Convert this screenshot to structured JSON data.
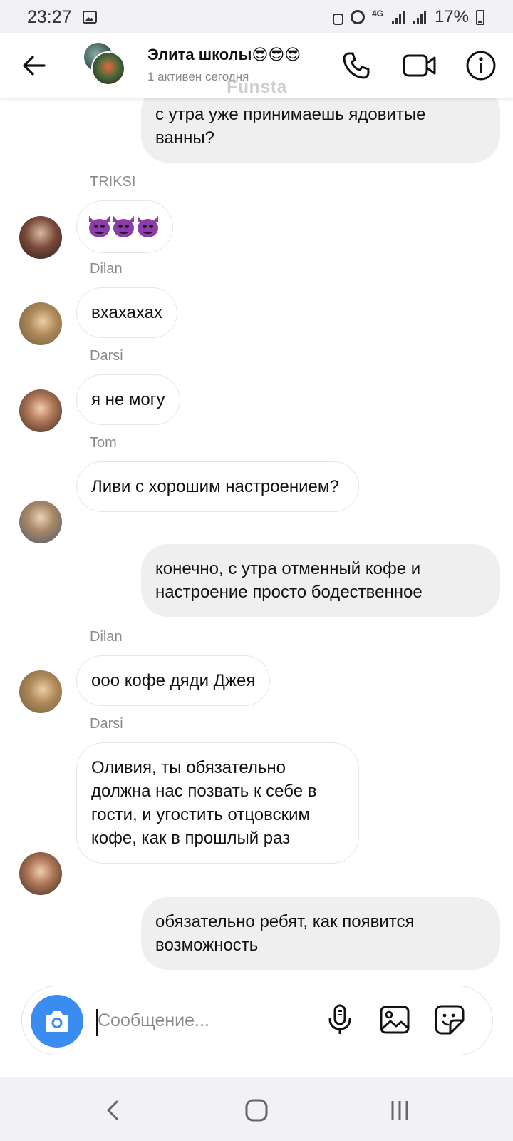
{
  "status": {
    "time": "23:27",
    "network": "4G",
    "battery": "17%"
  },
  "header": {
    "title": "Элита школы😎😎😎",
    "subtitle": "1 активен сегодня",
    "watermark": "Funsta"
  },
  "messages": [
    {
      "direction": "out",
      "text": "с утра уже принимаешь ядовитые ванны?"
    },
    {
      "direction": "in",
      "sender": "TRIKSI",
      "emoji": [
        "devil",
        "devil",
        "devil"
      ]
    },
    {
      "direction": "in",
      "sender": "Dilan",
      "text": "вхахахах"
    },
    {
      "direction": "in",
      "sender": "Darsi",
      "text": "я не могу"
    },
    {
      "direction": "in",
      "sender": "Tom",
      "text": "Ливи с хорошим настроением?"
    },
    {
      "direction": "out",
      "text": "конечно, с утра отменный кофе и настроение просто бодественное"
    },
    {
      "direction": "in",
      "sender": "Dilan",
      "text": "ооо кофе дяди Джея"
    },
    {
      "direction": "in",
      "sender": "Darsi",
      "text": "Оливия, ты обязательно должна нас позвать к себе в гости, и угостить отцовским кофе, как в прошлый раз"
    },
    {
      "direction": "out",
      "text": "обязательно ребят, как появится возможность"
    }
  ],
  "composer": {
    "placeholder": "Сообщение..."
  },
  "icons": {
    "header": [
      "back-arrow-icon",
      "phone-icon",
      "video-call-icon",
      "info-icon"
    ],
    "composer": [
      "camera-icon",
      "microphone-icon",
      "gallery-icon",
      "sticker-icon"
    ],
    "nav": [
      "nav-back-icon",
      "nav-home-icon",
      "nav-recents-icon"
    ]
  },
  "colors": {
    "accent": "#3b8cf0",
    "outgoing_bubble": "#efeff0",
    "incoming_bubble": "#ffffff",
    "sender_label": "#8a8a8a",
    "devil_emoji": "#8b3ea8"
  }
}
